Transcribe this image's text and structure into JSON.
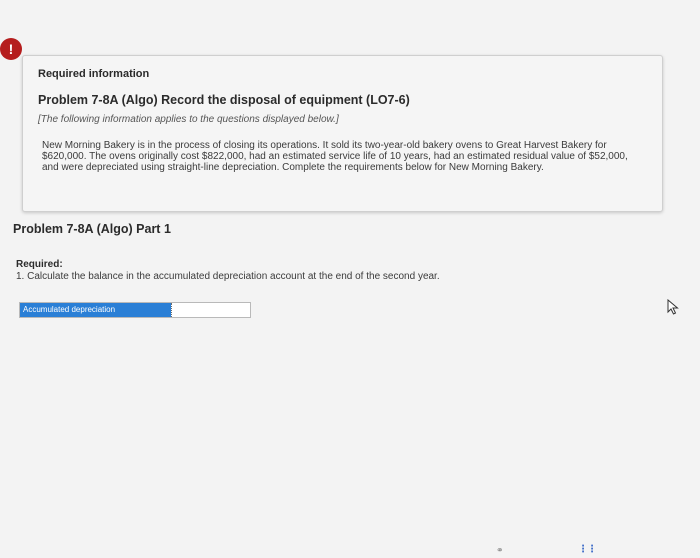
{
  "alert": {
    "symbol": "!"
  },
  "info": {
    "heading": "Required information",
    "problem_title": "Problem 7-8A (Algo) Record the disposal of equipment (LO7-6)",
    "applies_note": "[The following information applies to the questions displayed below.]",
    "scenario_text": "New Morning Bakery is in the process of closing its operations. It sold its two-year-old bakery ovens to Great Harvest Bakery for $620,000. The ovens originally cost $822,000, had an estimated service life of 10 years, had an estimated residual value of $52,000, and were depreciated using straight-line depreciation. Complete the requirements below for New Morning Bakery."
  },
  "part": {
    "title": "Problem 7-8A (Algo) Part 1",
    "required_label": "Required:",
    "required_item": "1. Calculate the balance in the accumulated depreciation account at the end of the second year."
  },
  "answer": {
    "label": "Accumulated depreciation",
    "value": ""
  },
  "colors": {
    "alert_red": "#b51d1d",
    "label_blue": "#2a7fd6"
  },
  "icons": {
    "alert": "exclamation-circle-icon",
    "cursor": "mouse-pointer-icon",
    "bottom_left": "page-link-icon",
    "bottom_right": "more-dots-icon"
  }
}
